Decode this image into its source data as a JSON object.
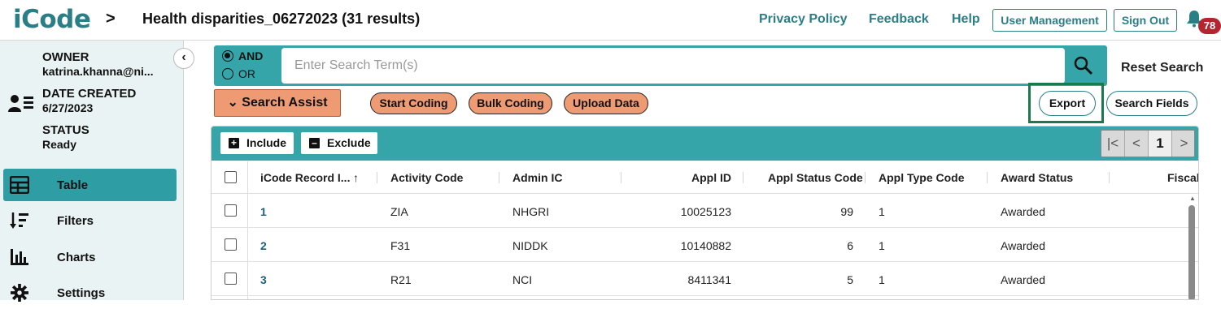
{
  "header": {
    "logo": "iCode",
    "title": "Health disparities_06272023 (31 results)",
    "links": [
      "Privacy Policy",
      "Feedback",
      "Help"
    ],
    "buttons": [
      "User Management",
      "Sign Out"
    ],
    "notification_count": "78"
  },
  "sidebar": {
    "owner_label": "OWNER",
    "owner_value": "katrina.khanna@ni...",
    "date_label": "DATE CREATED",
    "date_value": "6/27/2023",
    "status_label": "STATUS",
    "status_value": "Ready",
    "nav": [
      {
        "label": "Table",
        "icon": "table-icon",
        "active": true
      },
      {
        "label": "Filters",
        "icon": "filter-sort-icon",
        "active": false
      },
      {
        "label": "Charts",
        "icon": "bar-chart-icon",
        "active": false
      },
      {
        "label": "Settings",
        "icon": "gear-icon",
        "active": false
      }
    ]
  },
  "search": {
    "operators": [
      "AND",
      "OR"
    ],
    "selected_operator": "AND",
    "placeholder": "Enter Search Term(s)",
    "value": "",
    "reset_label": "Reset Search"
  },
  "actions": {
    "search_assist": "Search Assist",
    "start_coding": "Start Coding",
    "bulk_coding": "Bulk Coding",
    "upload_data": "Upload Data",
    "export": "Export",
    "search_fields": "Search Fields"
  },
  "table": {
    "include_label": "Include",
    "exclude_label": "Exclude",
    "current_page": "1",
    "columns": [
      "iCode Record I...",
      "Activity Code",
      "Admin IC",
      "Appl ID",
      "Appl Status Code",
      "Appl Type Code",
      "Award Status",
      "Fiscal Y"
    ],
    "rows": [
      {
        "record": "1",
        "activity": "ZIA",
        "admin": "NHGRI",
        "appl_id": "10025123",
        "status_code": "99",
        "type_code": "1",
        "award": "Awarded"
      },
      {
        "record": "2",
        "activity": "F31",
        "admin": "NIDDK",
        "appl_id": "10140882",
        "status_code": "6",
        "type_code": "1",
        "award": "Awarded"
      },
      {
        "record": "3",
        "activity": "R21",
        "admin": "NCI",
        "appl_id": "8411341",
        "status_code": "5",
        "type_code": "1",
        "award": "Awarded"
      }
    ]
  },
  "colors": {
    "teal": "#35a5a9",
    "teal_dark": "#2a7f87",
    "orange": "#ee9a73",
    "badge_red": "#b3262f",
    "highlight_green": "#1a7a4e"
  }
}
